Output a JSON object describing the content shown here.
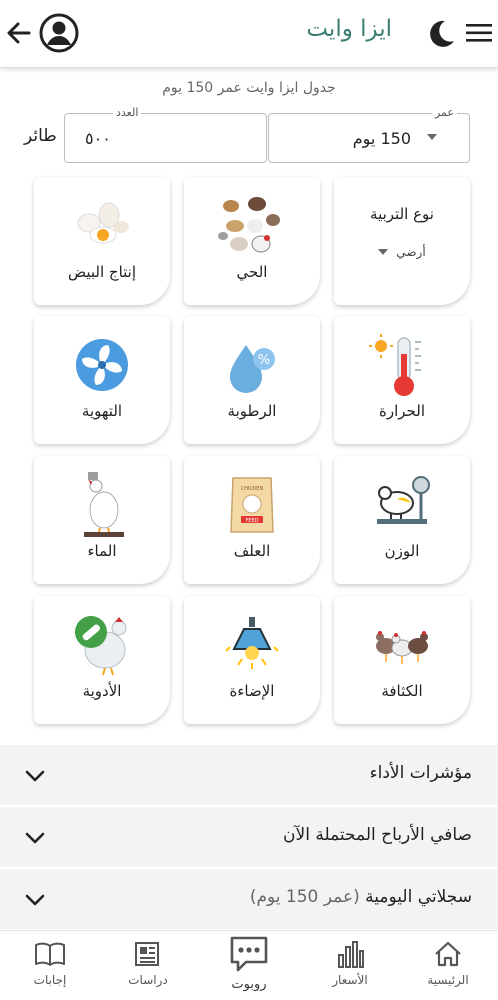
{
  "header": {
    "title": "ايزا وايت"
  },
  "subtitle": "جدول ايزا وايت عمر 150 يوم",
  "inputs": {
    "age": {
      "label": "عمر",
      "value": "150 يوم"
    },
    "count": {
      "label": "العدد",
      "value": "٥٠٠"
    },
    "unit": "طائر"
  },
  "tiles": {
    "breeding": {
      "title": "نوع التربية",
      "value": "أرضي"
    },
    "live": "الحي",
    "eggs": "إنتاج البيض",
    "temperature": "الحرارة",
    "humidity": "الرطوبة",
    "ventilation": "التهوية",
    "weight": "الوزن",
    "feed": "العلف",
    "water": "الماء",
    "density": "الكثافة",
    "lighting": "الإضاءة",
    "medicine": "الأدوية"
  },
  "sacklabel": {
    "top": "CHICKEN",
    "bottom": "FEED"
  },
  "accordion": {
    "performance": "مؤشرات الأداء",
    "profit": "صافي الأرباح المحتملة الآن",
    "logs": "سجلاتي اليومية",
    "logs_suffix": "(عمر 150 يوم)"
  },
  "nav": {
    "home": "الرئيسية",
    "prices": "الأسعار",
    "robot": "روبوت",
    "studies": "دراسات",
    "answers": "إجابات"
  },
  "colors": {
    "accent": "#3d7f74",
    "temp_red": "#e53935",
    "humidity_blue": "#6aaee0",
    "fan_blue": "#4a9be0",
    "medicine_green": "#43a047"
  }
}
